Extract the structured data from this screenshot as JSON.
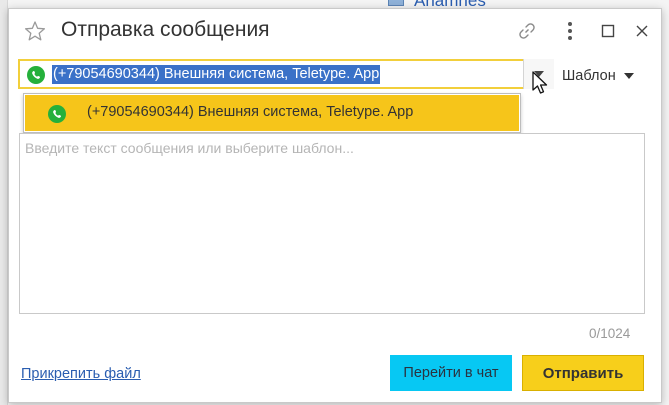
{
  "dialog": {
    "title": "Отправка сообщения"
  },
  "channel": {
    "selected_value": "(+79054690344) Внешняя система, Teletype. App",
    "options": [
      {
        "label": "(+79054690344) Внешняя система, Teletype. App",
        "icon": "whatsapp-icon"
      }
    ]
  },
  "template": {
    "label": "Шаблон"
  },
  "message": {
    "placeholder": "Введите текст сообщения или выберите шаблон...",
    "counter": "0/1024"
  },
  "footer": {
    "attach_label": "Прикрепить файл",
    "chat_label": "Перейти в чат",
    "send_label": "Отправить"
  },
  "background": {
    "partial_text": "Anamnes"
  },
  "colors": {
    "accent_yellow": "#f6c51a",
    "chat_button": "#07c8f3",
    "selection_blue": "#3a71c8",
    "link_blue": "#2a5db0",
    "whatsapp_green": "#25b03b"
  }
}
